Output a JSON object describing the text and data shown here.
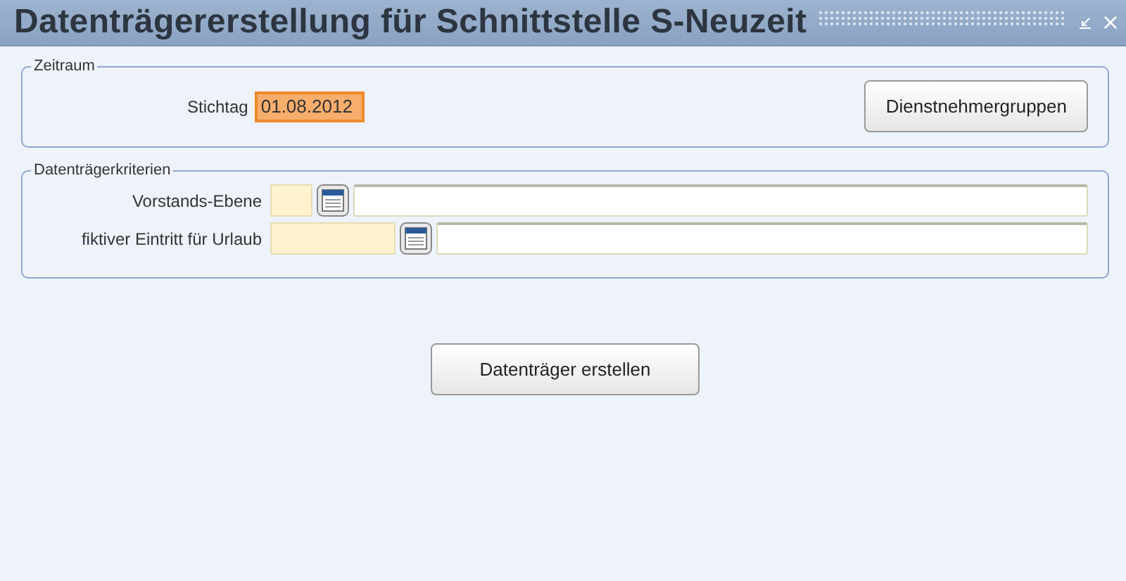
{
  "window": {
    "title": "Datenträgererstellung für Schnittstelle S-Neuzeit"
  },
  "zeitraum": {
    "legend": "Zeitraum",
    "field": {
      "label": "Stichtag",
      "value": "01.08.2012",
      "focused": true
    },
    "button": "Dienstnehmergruppen"
  },
  "kriterien": {
    "legend": "Datenträgerkriterien",
    "rows": [
      {
        "label": "Vorstands-Ebene",
        "kind": "code"
      },
      {
        "label": "fiktiver Eintritt für Urlaub",
        "kind": "date"
      }
    ]
  },
  "action_button": "Datenträger erstellen"
}
